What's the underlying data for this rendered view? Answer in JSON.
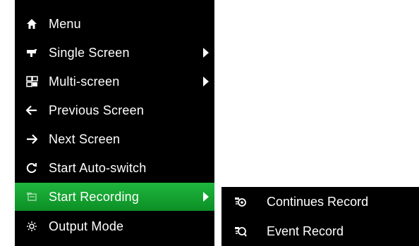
{
  "menu": {
    "items": [
      {
        "label": "Menu",
        "icon": "home-icon",
        "has_submenu": false
      },
      {
        "label": "Single Screen",
        "icon": "camera-icon",
        "has_submenu": true
      },
      {
        "label": "Multi-screen",
        "icon": "multi-screen-icon",
        "has_submenu": true
      },
      {
        "label": "Previous Screen",
        "icon": "arrow-left-icon",
        "has_submenu": false
      },
      {
        "label": "Next Screen",
        "icon": "arrow-right-icon",
        "has_submenu": false
      },
      {
        "label": "Start Auto-switch",
        "icon": "refresh-icon",
        "has_submenu": false
      },
      {
        "label": "Start Recording",
        "icon": "record-icon",
        "has_submenu": true,
        "active": true
      },
      {
        "label": "Output Mode",
        "icon": "output-mode-icon",
        "has_submenu": false
      }
    ]
  },
  "submenu": {
    "items": [
      {
        "label": "Continues Record",
        "icon": "continuous-record-icon"
      },
      {
        "label": "Event Record",
        "icon": "event-record-icon"
      }
    ]
  },
  "colors": {
    "menu_bg": "#000000",
    "active_bg": "#12a030",
    "text": "#ffffff",
    "page_bg": "#ffffff"
  }
}
